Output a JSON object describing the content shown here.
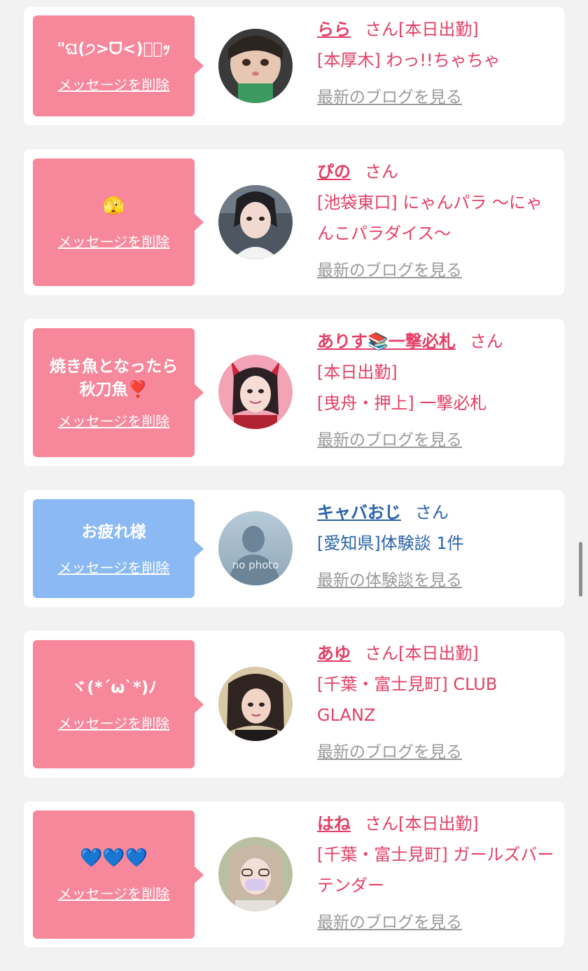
{
  "colors": {
    "pink": "#f7879a",
    "blue": "#8bb9f4",
    "name_pink": "#e43f66",
    "name_blue": "#2a63a8",
    "link_gray": "#9a9a9a"
  },
  "cards": [
    {
      "message": "\"ଘ(੭>ᗜ<)੭゙ｯ",
      "delete_label": "メッセージを削除",
      "name": "らら",
      "san": "さん",
      "status": "[本日出勤]",
      "shop": "[本厚木] わっ!!ちゃちゃ",
      "link": "最新のブログを見る"
    },
    {
      "message": "🫣",
      "delete_label": "メッセージを削除",
      "name": "ぴの",
      "san": "さん",
      "status": "",
      "shop": "[池袋東口] にゃんパラ ～にゃんこパラダイス～",
      "link": "最新のブログを見る"
    },
    {
      "message": "焼き魚となったら秋刀魚❣️",
      "delete_label": "メッセージを削除",
      "name": "ありす📚一撃必札",
      "san": "さん",
      "status": "[本日出勤]",
      "shop": "[曳舟・押上] 一撃必札",
      "link": "最新のブログを見る"
    },
    {
      "message": "お疲れ様",
      "delete_label": "メッセージを削除",
      "name": "キャバおじ",
      "san": "さん",
      "status": "",
      "shop": "[愛知県]体験談 1件",
      "link": "最新の体験談を見る",
      "avatar_label": "no photo"
    },
    {
      "message": "ヾ(*´ω`*)ﾉ",
      "delete_label": "メッセージを削除",
      "name": "あゆ",
      "san": "さん",
      "status": "[本日出勤]",
      "shop": "[千葉・富士見町] CLUB GLANZ",
      "link": "最新のブログを見る"
    },
    {
      "message": "💙💙💙",
      "delete_label": "メッセージを削除",
      "name": "はね",
      "san": "さん",
      "status": "[本日出勤]",
      "shop": "[千葉・富士見町] ガールズバー テンダー",
      "link": "最新のブログを見る"
    }
  ]
}
